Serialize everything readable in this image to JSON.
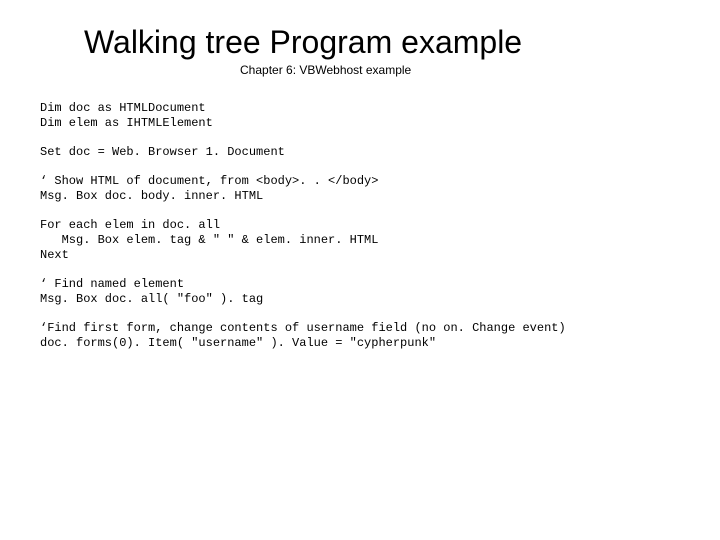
{
  "title": "Walking tree Program example",
  "subtitle": "Chapter 6: VBWebhost example",
  "code": {
    "b1": "Dim doc as HTMLDocument\nDim elem as IHTMLElement",
    "b2": "Set doc = Web. Browser 1. Document",
    "b3": "‘ Show HTML of document, from <body>. . </body>\nMsg. Box doc. body. inner. HTML",
    "b4": "For each elem in doc. all\n   Msg. Box elem. tag & \" \" & elem. inner. HTML\nNext",
    "b5": "‘ Find named element\nMsg. Box doc. all( \"foo\" ). tag",
    "b6": "‘Find first form, change contents of username field (no on. Change event)\ndoc. forms(0). Item( \"username\" ). Value = \"cypherpunk\""
  }
}
